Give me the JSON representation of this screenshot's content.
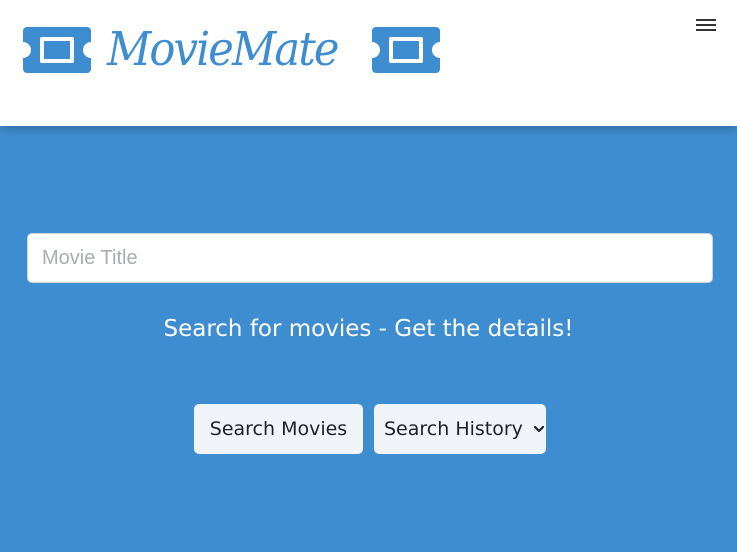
{
  "header": {
    "brand_name": "MovieMate",
    "brand_color": "#3f8dd1",
    "left_icon": "ticket-icon",
    "right_icon": "ticket-icon",
    "menu_icon": "hamburger-menu-icon"
  },
  "hero": {
    "background_color": "#3f8dd1",
    "search": {
      "placeholder": "Movie Title",
      "value": ""
    },
    "tagline": "Search for movies - Get the details!",
    "buttons": {
      "search_movies": "Search Movies",
      "search_history": "Search History",
      "search_history_icon": "chevron-down-icon"
    }
  }
}
